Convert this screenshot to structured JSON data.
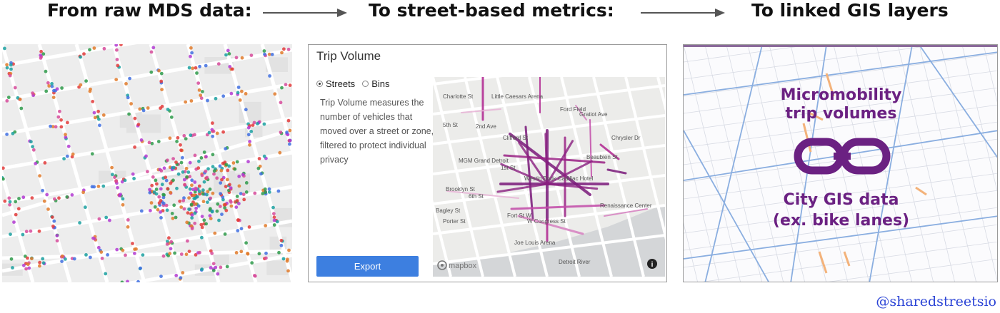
{
  "headings": {
    "step1": "From raw MDS data:",
    "step2": "To street-based metrics:",
    "step3": "To linked GIS layers"
  },
  "metrics_panel": {
    "title": "Trip Volume",
    "radio_options": [
      {
        "label": "Streets",
        "selected": true
      },
      {
        "label": "Bins",
        "selected": false
      }
    ],
    "description": "Trip Volume measures the number of vehicles that moved over a street or zone, filtered to protect individual privacy",
    "export_label": "Export",
    "map_attribution": "mapbox",
    "map_labels": [
      "Charlotte St",
      "Little Caesars Arena",
      "Ford Field",
      "Gratiot Ave",
      "5th St",
      "2nd Ave",
      "Clifford St",
      "Chrysler Dr",
      "Beaubien St",
      "MGM Grand Detroit",
      "1st St",
      "Westin Book Cadillac Hotel",
      "Brooklyn St",
      "6th St",
      "Bagley St",
      "Porter St",
      "Fort St W",
      "W Congress St",
      "Renaissance Center",
      "Joe Louis Arena",
      "Detroit River"
    ]
  },
  "gis_panel": {
    "label_top": [
      "Micromobility",
      "trip volumes"
    ],
    "label_bottom": [
      "City GIS data",
      "(ex. bike lanes)"
    ]
  },
  "credit": "@sharedstreetsio",
  "colors": {
    "accent_purple": "#6b2182",
    "arrow_gray": "#555555",
    "export_blue": "#3d7fe0",
    "credit_blue": "#2b44d6",
    "bike_lane_blue": "#8aaee0",
    "trip_orange": "#f3b27a",
    "trip_magenta": "#b0258f"
  },
  "icons": [
    "arrow-right-icon",
    "chain-link-icon",
    "info-icon",
    "mapbox-logo-icon"
  ]
}
